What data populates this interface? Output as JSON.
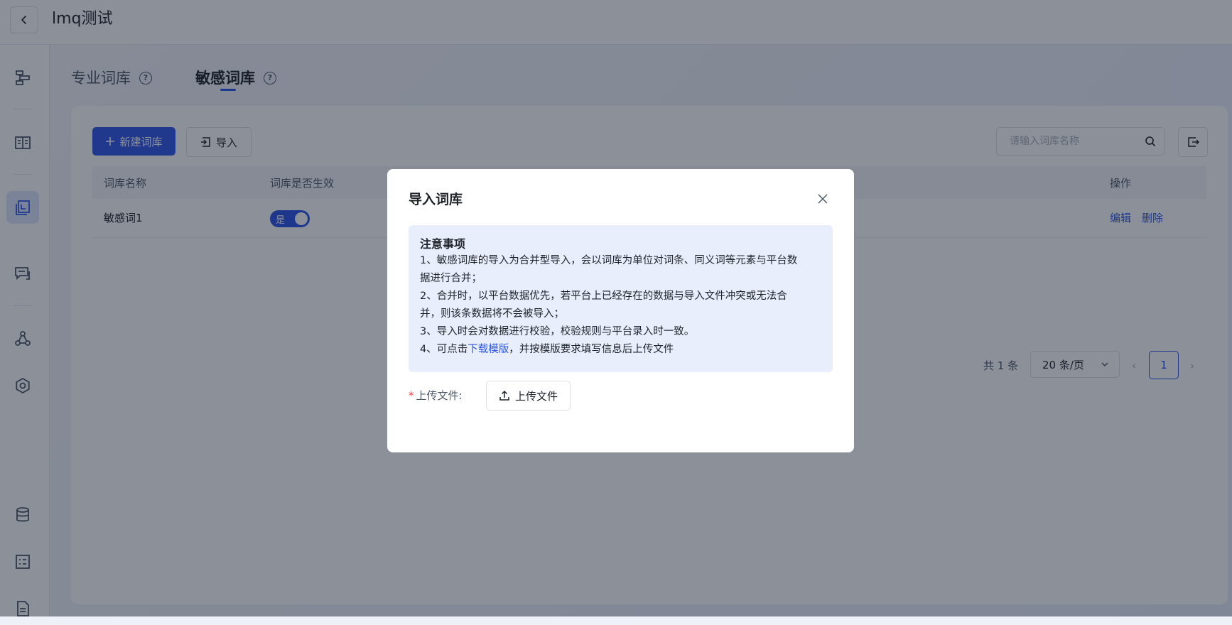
{
  "header": {
    "title": "lmq测试"
  },
  "sidebar": {
    "icons": [
      "flow-icon",
      "book-icon",
      "dictionary-icon",
      "chat-icon",
      "graph-icon",
      "settings-icon",
      "database-icon",
      "form-icon",
      "document-icon"
    ],
    "active_icon": "dictionary-icon"
  },
  "tabs": [
    {
      "label": "专业词库",
      "active": false
    },
    {
      "label": "敏感词库",
      "active": true
    }
  ],
  "toolbar": {
    "new_label": "新建词库",
    "import_label": "导入",
    "search_placeholder": "请输入词库名称"
  },
  "table": {
    "columns": [
      "词库名称",
      "词库是否生效",
      "操作"
    ],
    "rows": [
      {
        "name": "敏感词1",
        "enabled_label": "是",
        "enabled": true,
        "edit": "编辑",
        "delete": "删除"
      }
    ]
  },
  "pagination": {
    "total": "共 1 条",
    "page_size": "20 条/页",
    "current": "1"
  },
  "modal": {
    "title": "导入词库",
    "notice_title": "注意事项",
    "line1a": "1、敏感词库的导入为合并型导入，会以词库为单位对词条、同义词等元素与平台数",
    "line1b": "据进行合并；",
    "line2a": "2、合并时，以平台数据优先，若平台上已经存在的数据与导入文件冲突或无法合",
    "line2b": "并，则该条数据将不会被导入；",
    "line3": "3、导入时会对数据进行校验，校验规则与平台录入时一致。",
    "line4_prefix": "4、可点击",
    "line4_link": "下载模版",
    "line4_suffix": "，并按模版要求填写信息后上传文件",
    "upload_label": "上传文件:",
    "upload_button": "上传文件"
  },
  "colors": {
    "primary": "#3058e6",
    "link": "#2a55e5",
    "notice_bg": "#e8eefc",
    "required": "#e5484d"
  }
}
